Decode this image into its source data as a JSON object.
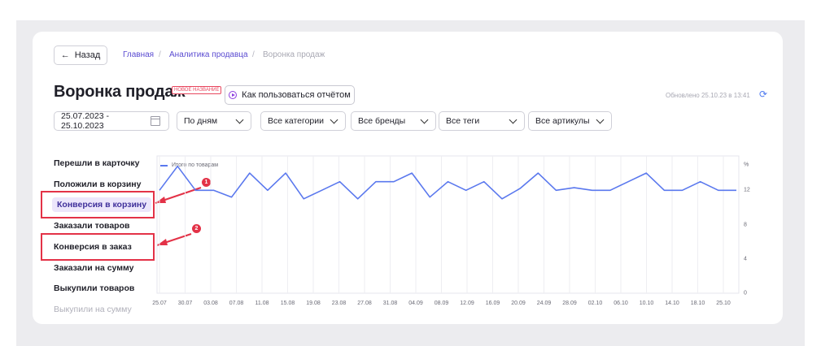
{
  "nav": {
    "back_label": "Назад",
    "breadcrumbs": [
      "Главная",
      "/",
      "Аналитика продавца",
      "/",
      "Воронка продаж"
    ]
  },
  "header": {
    "title": "Воронка продаж",
    "badge": "НОВОЕ НАЗВАНИЕ",
    "how_to_label": "Как пользоваться отчётом",
    "updated": "Обновлено 25.10.23 в 13:41"
  },
  "filters": {
    "date_range": "25.07.2023 - 25.10.2023",
    "granularity": "По дням",
    "categories": "Все категории",
    "brands": "Все бренды",
    "tags": "Все теги",
    "articles": "Все артикулы"
  },
  "metrics": [
    "Перешли в карточку",
    "Положили в корзину",
    "Конверсия в корзину",
    "Заказали товаров",
    "Конверсия в заказ",
    "Заказали на сумму",
    "Выкупили товаров",
    "Выкупили на сумму"
  ],
  "annotations": [
    "1",
    "2"
  ],
  "colors": {
    "accent": "#5a78ee",
    "highlight": "#e33247",
    "active_bg": "#ece6fb"
  },
  "chart_data": {
    "type": "line",
    "x": [
      "25.07",
      "30.07",
      "03.08",
      "07.08",
      "11.08",
      "15.08",
      "19.08",
      "23.08",
      "27.08",
      "31.08",
      "04.09",
      "08.09",
      "12.09",
      "16.09",
      "20.09",
      "24.09",
      "28.09",
      "02.10",
      "06.10",
      "10.10",
      "14.10",
      "18.10",
      "25.10"
    ],
    "series": [
      {
        "name": "Итого по товарам",
        "values": [
          12.0,
          14.8,
          12.0,
          12.0,
          11.2,
          14.0,
          12.0,
          14.0,
          11.0,
          12.0,
          13.0,
          11.0,
          13.0,
          13.0,
          14.0,
          11.2,
          13.0,
          12.0,
          13.0,
          11.0,
          12.2,
          14.0,
          12.0,
          12.3,
          12.0,
          12.0,
          13.0,
          14.0,
          12.0,
          12.0,
          13.0,
          12.0,
          12.0
        ]
      }
    ],
    "y_ticks": [
      "0",
      "4",
      "8",
      "12",
      "%"
    ],
    "ylim": [
      0,
      16
    ],
    "grid": true,
    "legend": "top-left"
  }
}
